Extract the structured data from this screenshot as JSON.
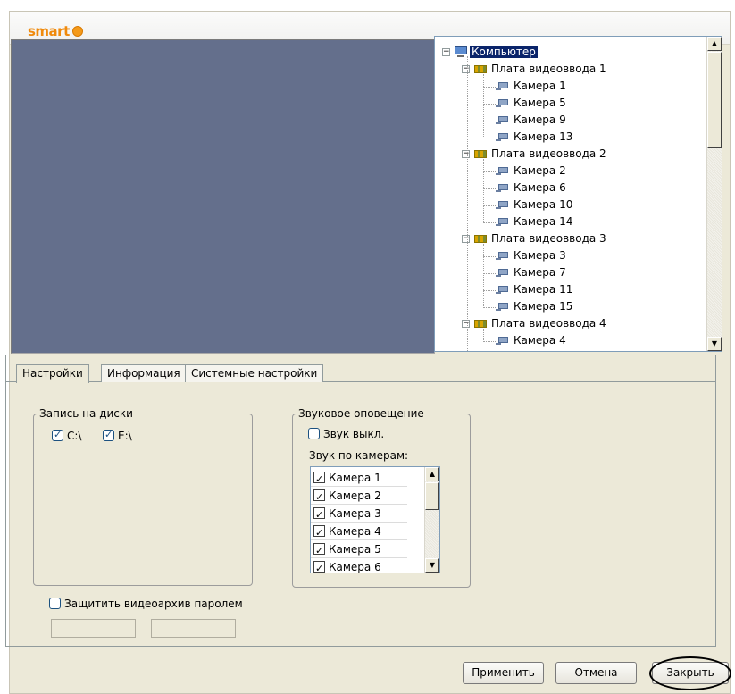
{
  "header": {
    "logo_text": "smart"
  },
  "tree": {
    "root": "Компьютер",
    "boards": [
      {
        "label": "Плата видеоввода 1",
        "cameras": [
          "Камера 1",
          "Камера 5",
          "Камера 9",
          "Камера 13"
        ]
      },
      {
        "label": "Плата видеоввода 2",
        "cameras": [
          "Камера 2",
          "Камера 6",
          "Камера 10",
          "Камера 14"
        ]
      },
      {
        "label": "Плата видеоввода 3",
        "cameras": [
          "Камера 3",
          "Камера 7",
          "Камера 11",
          "Камера 15"
        ]
      },
      {
        "label": "Плата видеоввода 4",
        "cameras": [
          "Камера 4"
        ]
      }
    ]
  },
  "tabs": [
    {
      "label": "Настройки",
      "active": true
    },
    {
      "label": "Информация",
      "active": false
    },
    {
      "label": "Системные настройки",
      "active": false
    }
  ],
  "disks": {
    "title": "Запись на диски",
    "drives": [
      {
        "label": "C:\\",
        "checked": true
      },
      {
        "label": "E:\\",
        "checked": true
      }
    ]
  },
  "sound": {
    "title": "Звуковое оповещение",
    "mute_label": "Звук выкл.",
    "mute_checked": false,
    "per_camera_label": "Звук по камерам:",
    "cameras": [
      {
        "label": "Камера 1",
        "checked": true
      },
      {
        "label": "Камера 2",
        "checked": true
      },
      {
        "label": "Камера 3",
        "checked": true
      },
      {
        "label": "Камера 4",
        "checked": true
      },
      {
        "label": "Камера 5",
        "checked": true
      },
      {
        "label": "Камера 6",
        "checked": true
      }
    ]
  },
  "protect": {
    "label": "Защитить видеоархив паролем",
    "checked": false
  },
  "buttons": {
    "apply": "Применить",
    "cancel": "Отмена",
    "close": "Закрыть"
  },
  "colors": {
    "video_bg": "#646f8c",
    "selection": "#0a246a",
    "logo": "#f08a0c"
  }
}
